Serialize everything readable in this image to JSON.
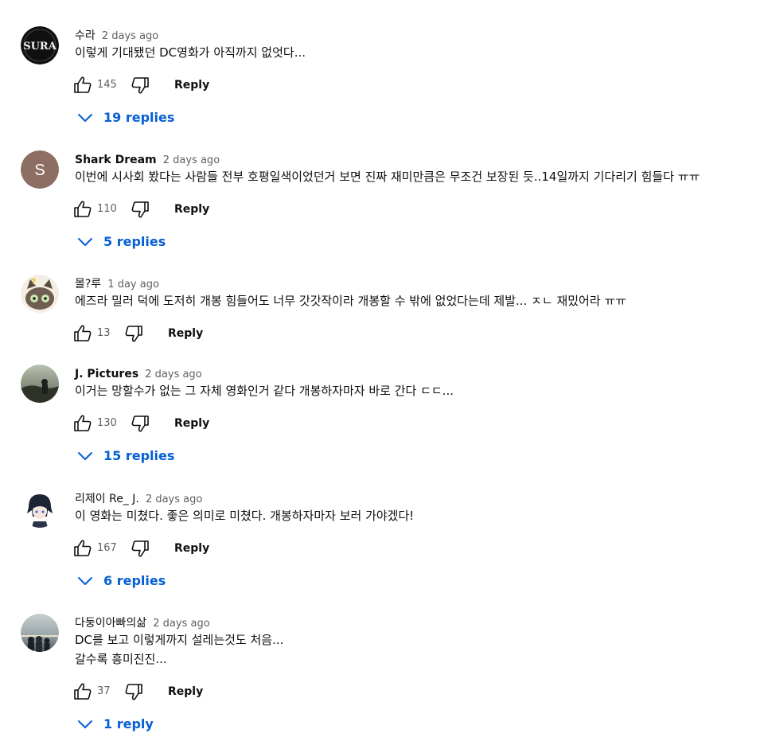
{
  "comments": [
    {
      "author": "수라",
      "time": "2 days ago",
      "text": "이렇게 기대됐던 DC영화가 아직까지 없엇다...",
      "likes": "145",
      "reply_label": "Reply",
      "replies_label": "19 replies",
      "avatar_text": "SURA"
    },
    {
      "author": "Shark Dream",
      "time": "2 days ago",
      "text": "이번에 시사회 봤다는 사람들 전부 호평일색이었던거 보면 진짜 재미만큼은 무조건 보장된 듯..14일까지 기다리기 힘들다 ㅠㅠ",
      "likes": "110",
      "reply_label": "Reply",
      "replies_label": "5 replies",
      "avatar_text": "S",
      "avatar_color": "#8d6e63"
    },
    {
      "author": "몰?루",
      "time": "1 day ago",
      "text": "에즈라 밀러 덕에 도저히 개봉 힘들어도 너무 갓갓작이라 개봉할 수 밖에 없었다는데 제발... ㅈㄴ 재밌어라 ㅠㅠ",
      "likes": "13",
      "reply_label": "Reply"
    },
    {
      "author": "J. Pictures",
      "time": "2 days ago",
      "text": "이거는 망할수가 없는 그 자체 영화인거 같다 개봉하자마자 바로 간다 ㄷㄷ...",
      "likes": "130",
      "reply_label": "Reply",
      "replies_label": "15 replies"
    },
    {
      "author": "리제이 Re_ J.",
      "time": "2 days ago",
      "text": "이 영화는 미쳤다. 좋은 의미로 미쳤다. 개봉하자마자 보러 가야겠다!",
      "likes": "167",
      "reply_label": "Reply",
      "replies_label": "6 replies"
    },
    {
      "author": "다둥이아빠의삶",
      "time": "2 days ago",
      "text": "DC를 보고 이렇게까지 설레는것도 처음...\n갈수록 흥미진진...",
      "likes": "37",
      "reply_label": "Reply",
      "replies_label": "1 reply"
    }
  ],
  "colors": {
    "link": "#065fd4",
    "secondary_text": "#606060",
    "primary_text": "#0f0f0f"
  },
  "icons": [
    "thumbs-up-icon",
    "thumbs-down-icon",
    "chevron-down-icon"
  ]
}
